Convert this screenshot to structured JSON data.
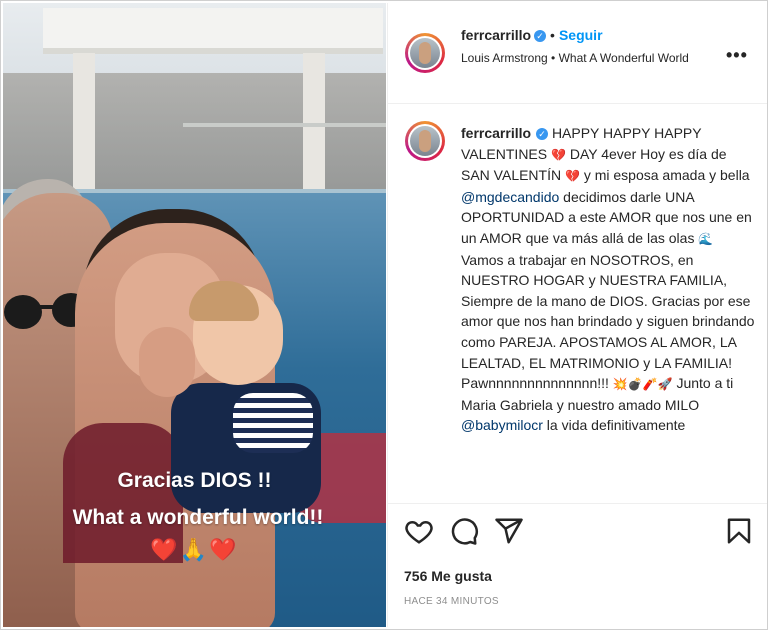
{
  "post": {
    "username": "ferrcarrillo",
    "verified_glyph": "✓",
    "follow_label": "Seguir",
    "dot": "•",
    "audio": "Louis Armstrong • What A Wonderful World",
    "more_icon": "•••"
  },
  "media": {
    "caption_line1": "Gracias DIOS !!",
    "caption_line2": "What a wonderful world!!",
    "caption_emojis": "❤️🙏❤️"
  },
  "caption": {
    "seg1": "HAPPY HAPPY HAPPY VALENTINES",
    "seg2": "DAY 4ever Hoy es día de SAN VALENTÍN",
    "seg3": "y mi esposa amada y bella",
    "mention1": "@mgdecandido",
    "seg4": "decidimos darle UNA OPORTUNIDAD a este AMOR que nos une en un AMOR que va más allá de las olas",
    "seg5": "Vamos a trabajar en NOSOTROS, en NUESTRO HOGAR y NUESTRA FAMILIA, Siempre de la mano de DIOS. Gracias por ese amor que nos han brindado y siguen brindando como PAREJA. APOSTAMOS AL AMOR, LA LEALTAD, EL MATRIMONIO y LA FAMILIA! Pawnnnnnnnnnnnnnn!!!",
    "seg6": "Junto a ti Maria Gabriela y nuestro amado MILO",
    "mention2": "@babymilocr",
    "seg7": "la vida definitivamente",
    "emoji_heart": "💔",
    "emoji_wave": "🌊",
    "emoji_row": "💥💣🧨🚀"
  },
  "actions": {
    "like_icon": "heart-icon",
    "comment_icon": "comment-icon",
    "share_icon": "share-icon",
    "save_icon": "bookmark-icon",
    "likes": "756 Me gusta",
    "timestamp": "HACE 34 MINUTOS"
  },
  "colors": {
    "accent": "#0095f6",
    "text": "#262626",
    "muted": "#8e8e8e",
    "mention": "#00376b",
    "verified": "#3897f0"
  }
}
